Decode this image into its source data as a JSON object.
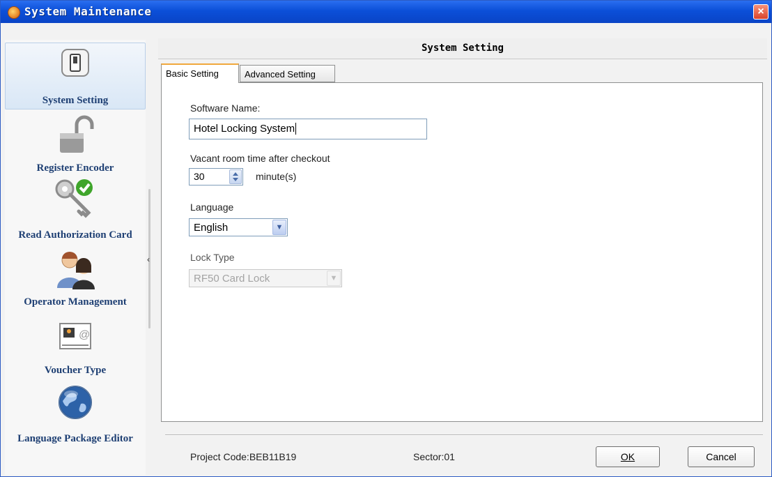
{
  "window": {
    "title": "System Maintenance"
  },
  "sidebar": {
    "items": [
      {
        "label": "System Setting",
        "icon": "switch-icon",
        "selected": true
      },
      {
        "label": "Register Encoder",
        "icon": "padlock-icon"
      },
      {
        "label": "Read Authorization Card",
        "icon": "key-check-icon"
      },
      {
        "label": "Operator Management",
        "icon": "users-icon"
      },
      {
        "label": "Voucher Type",
        "icon": "voucher-icon"
      },
      {
        "label": "Language Package Editor",
        "icon": "globe-icon"
      }
    ]
  },
  "panel": {
    "title": "System Setting",
    "tabs": [
      {
        "label": "Basic Setting",
        "active": true
      },
      {
        "label": "Advanced Setting",
        "active": false
      }
    ]
  },
  "form": {
    "software_name_label": "Software Name:",
    "software_name_value": "Hotel Locking System",
    "vacant_label": "Vacant room time after checkout",
    "vacant_value": "30",
    "vacant_unit": "minute(s)",
    "language_label": "Language",
    "language_value": "English",
    "lock_type_label": "Lock Type",
    "lock_type_value": "RF50 Card Lock"
  },
  "footer": {
    "project_code": "Project Code:BEB11B19",
    "sector": "Sector:01",
    "ok_label": "OK",
    "cancel_label": "Cancel"
  }
}
